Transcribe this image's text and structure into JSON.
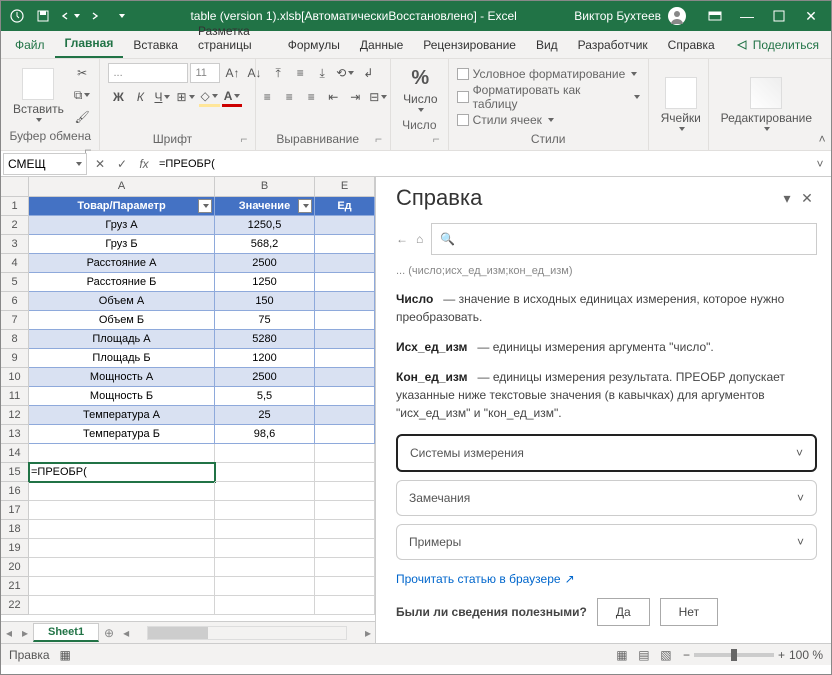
{
  "titlebar": {
    "title": "table (version 1).xlsb[АвтоматическиВосстановлено] - Excel",
    "user": "Виктор Бухтеев"
  },
  "tabs": {
    "file": "Файл",
    "home": "Главная",
    "insert": "Вставка",
    "layout": "Разметка страницы",
    "formulas": "Формулы",
    "data": "Данные",
    "review": "Рецензирование",
    "view": "Вид",
    "developer": "Разработчик",
    "help": "Справка",
    "share": "Поделиться"
  },
  "ribbon": {
    "clipboard": "Буфер обмена",
    "paste": "Вставить",
    "font": "Шрифт",
    "alignment": "Выравнивание",
    "number_group": "Число",
    "number_btn": "Число",
    "styles": "Стили",
    "cells": "Ячейки",
    "editing": "Редактирование",
    "cond_format": "Условное форматирование",
    "format_table": "Форматировать как таблицу",
    "cell_styles": "Стили ячеек",
    "font_name": "...",
    "font_size": "11"
  },
  "fx": {
    "namebox": "СМЕЩ",
    "formula": "=ПРЕОБР("
  },
  "grid": {
    "col_a": "A",
    "col_b": "B",
    "col_c": "Е",
    "headers": {
      "a": "Товар/Параметр",
      "b": "Значение",
      "c": "Ед"
    },
    "rows": [
      {
        "a": "Груз А",
        "b": "1250,5"
      },
      {
        "a": "Груз Б",
        "b": "568,2"
      },
      {
        "a": "Расстояние А",
        "b": "2500"
      },
      {
        "a": "Расстояние Б",
        "b": "1250"
      },
      {
        "a": "Объем А",
        "b": "150"
      },
      {
        "a": "Объем Б",
        "b": "75"
      },
      {
        "a": "Площадь А",
        "b": "5280"
      },
      {
        "a": "Площадь Б",
        "b": "1200"
      },
      {
        "a": "Мощность А",
        "b": "2500"
      },
      {
        "a": "Мощность Б",
        "b": "5,5"
      },
      {
        "a": "Температура А",
        "b": "25"
      },
      {
        "a": "Температура Б",
        "b": "98,6"
      }
    ],
    "active_cell": "=ПРЕОБР(",
    "sheet": "Sheet1"
  },
  "help": {
    "title": "Справка",
    "truncated": "... (число;исх_ед_изм;кон_ед_изм)",
    "p_num_label": "Число",
    "p_num_text": "— значение в исходных единицах измерения, которое нужно преобразовать.",
    "p_from_label": "Исх_ед_изм",
    "p_from_text": "— единицы измерения аргумента \"число\".",
    "p_to_label": "Кон_ед_изм",
    "p_to_text": "— единицы измерения результата. ПРЕОБР допускает указанные ниже текстовые значения (в кавычках) для аргументов \"исх_ед_изм\" и \"кон_ед_изм\".",
    "acc_systems": "Системы измерения",
    "acc_remarks": "Замечания",
    "acc_examples": "Примеры",
    "link": "Прочитать статью в браузере",
    "feedback_q": "Были ли сведения полезными?",
    "yes": "Да",
    "no": "Нет"
  },
  "status": {
    "mode": "Правка",
    "zoom": "100 %"
  }
}
